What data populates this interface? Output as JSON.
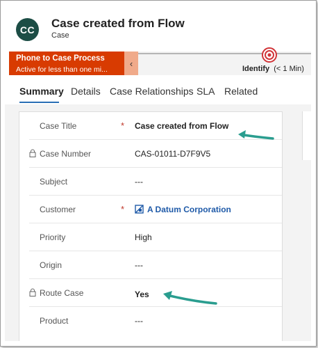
{
  "header": {
    "avatar_initials": "CC",
    "title": "Case created from Flow",
    "entity_type": "Case"
  },
  "process": {
    "stage_name": "Phone to Case Process",
    "stage_status": "Active for less than one mi...",
    "collapse_glyph": "‹",
    "current_step": "Identify",
    "current_step_duration": "(< 1 Min)",
    "accent_color": "#d83b01"
  },
  "tabs": [
    {
      "label": "Summary",
      "active": true
    },
    {
      "label": "Details",
      "active": false
    },
    {
      "label": "Case Relationships",
      "active": false
    },
    {
      "label": "SLA",
      "active": false
    },
    {
      "label": "Related",
      "active": false
    }
  ],
  "fields": [
    {
      "label": "Case Title",
      "value": "Case created from Flow",
      "required": true,
      "locked": false
    },
    {
      "label": "Case Number",
      "value": "CAS-01011-D7F9V5",
      "required": false,
      "locked": true
    },
    {
      "label": "Subject",
      "value": "---",
      "required": false,
      "locked": false
    },
    {
      "label": "Customer",
      "value": "A Datum Corporation",
      "required": true,
      "locked": false,
      "is_link": true,
      "icon": "account-icon"
    },
    {
      "label": "Priority",
      "value": "High",
      "required": false,
      "locked": false
    },
    {
      "label": "Origin",
      "value": "---",
      "required": false,
      "locked": false
    },
    {
      "label": "Route Case",
      "value": "Yes",
      "required": false,
      "locked": true
    },
    {
      "label": "Product",
      "value": "---",
      "required": false,
      "locked": false
    }
  ],
  "required_marker": "*",
  "annotation_arrow_color": "#2a9d8f"
}
